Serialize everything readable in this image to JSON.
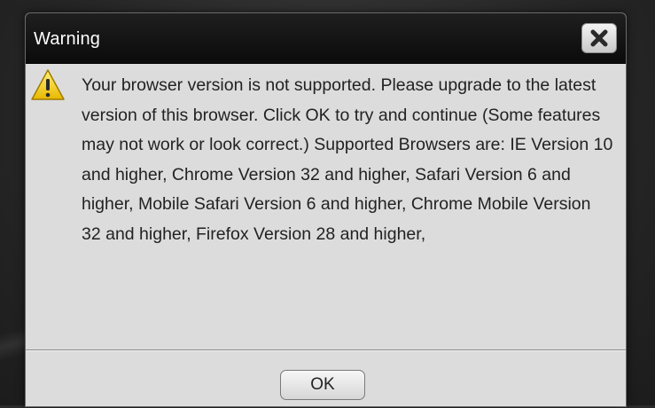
{
  "dialog": {
    "title": "Warning",
    "message": "Your browser version is not supported. Please upgrade to the latest version of this browser. Click OK to try and continue (Some features may not work or look correct.) Supported Browsers are: IE Version 10 and higher, Chrome Version 32 and higher, Safari Version 6 and higher, Mobile Safari Version 6 and higher, Chrome Mobile Version 32 and higher, Firefox Version 28 and higher,",
    "ok_label": "OK",
    "icons": {
      "warning": "warning-triangle-icon",
      "close": "close-icon"
    }
  },
  "colors": {
    "titlebar": "#111111",
    "dialog_body": "#dcdcdc",
    "warning_yellow": "#f5d21a",
    "text": "#222222"
  }
}
